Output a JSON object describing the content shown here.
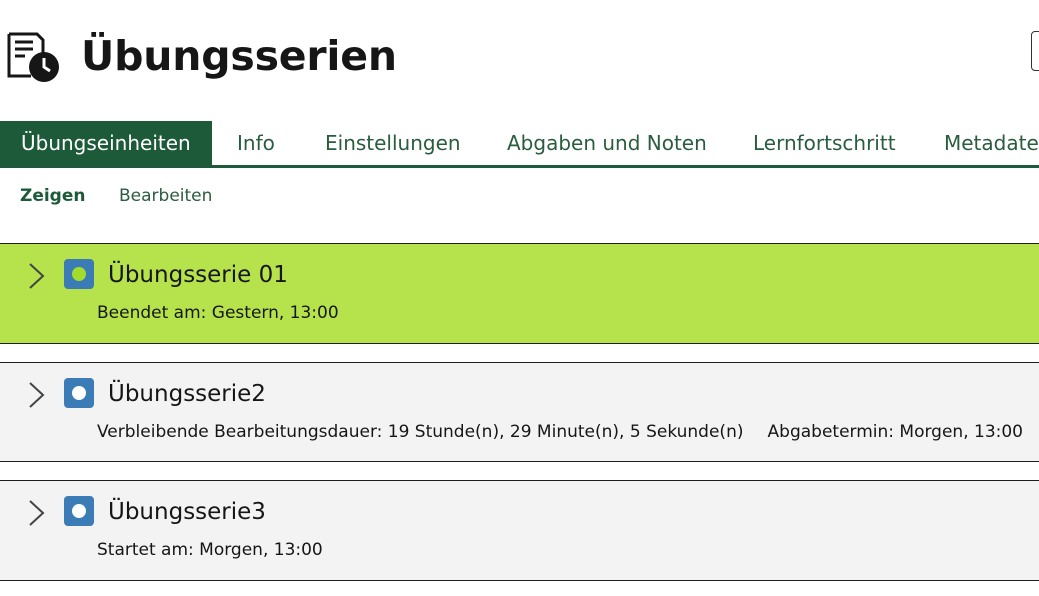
{
  "header": {
    "title": "Übungsserien",
    "icon": "exercise-schedule-icon"
  },
  "tabs": [
    {
      "label": "Übungseinheiten",
      "active": true
    },
    {
      "label": "Info",
      "active": false
    },
    {
      "label": "Einstellungen",
      "active": false
    },
    {
      "label": "Abgaben und Noten",
      "active": false
    },
    {
      "label": "Lernfortschritt",
      "active": false
    },
    {
      "label": "Metadaten",
      "active": false
    }
  ],
  "subtabs": [
    {
      "label": "Zeigen",
      "active": true
    },
    {
      "label": "Bearbeiten",
      "active": false
    }
  ],
  "items": [
    {
      "title": "Übungsserie 01",
      "meta": "Beendet am: Gestern, 13:00",
      "meta2": "",
      "state": "finished",
      "dot_color": "#a3dd2c",
      "background": "#b6e24c"
    },
    {
      "title": "Übungsserie2",
      "meta": "Verbleibende Bearbeitungsdauer: 19 Stunde(n), 29 Minute(n), 5 Sekunde(n)",
      "meta2": "Abgabetermin: Morgen, 13:00",
      "state": "running",
      "dot_color": "#ffffff",
      "background": "#f3f3f3"
    },
    {
      "title": "Übungsserie3",
      "meta": "Startet am: Morgen, 13:00",
      "meta2": "",
      "state": "upcoming",
      "dot_color": "#ffffff",
      "background": "#f3f3f3"
    }
  ],
  "colors": {
    "brand_green": "#1d5a3a",
    "status_blue": "#3b7bb6",
    "finished_green": "#b6e24c"
  }
}
